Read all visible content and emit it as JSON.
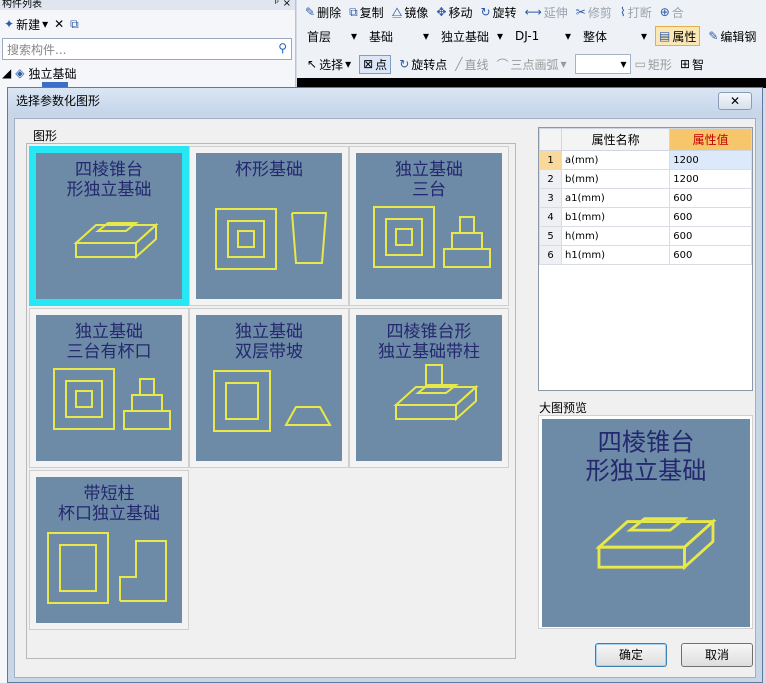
{
  "left_panel": {
    "title": "构件列表",
    "new_label": "新建",
    "search_placeholder": "搜索构件...",
    "tree_root": "独立基础"
  },
  "toolbar": {
    "row1": [
      "删除",
      "复制",
      "镜像",
      "移动",
      "旋转",
      "延伸",
      "修剪",
      "打断",
      "合"
    ],
    "row2": {
      "floor": "首层",
      "category": "基础",
      "type": "独立基础",
      "element": "DJ-1",
      "scope": "整体",
      "properties": "属性",
      "edit": "编辑钢"
    },
    "row3": {
      "select": "选择",
      "point": "点",
      "rotate_point": "旋转点",
      "line": "直线",
      "arc": "三点画弧",
      "rect": "矩形",
      "smart": "智"
    }
  },
  "dialog": {
    "title": "选择参数化图形",
    "close": "✕",
    "group_label": "图形",
    "shapes": [
      {
        "title1": "四棱锥台",
        "title2": "形独立基础"
      },
      {
        "title1": "杯形基础",
        "title2": ""
      },
      {
        "title1": "独立基础",
        "title2": "三台"
      },
      {
        "title1": "独立基础",
        "title2": "三台有杯口"
      },
      {
        "title1": "独立基础",
        "title2": "双层带坡"
      },
      {
        "title1": "四棱锥台形",
        "title2": "独立基础带柱"
      },
      {
        "title1": "带短柱",
        "title2": "杯口独立基础"
      }
    ],
    "properties": {
      "col_name": "属性名称",
      "col_value": "属性值",
      "rows": [
        {
          "idx": "1",
          "name": "a(mm)",
          "value": "1200"
        },
        {
          "idx": "2",
          "name": "b(mm)",
          "value": "1200"
        },
        {
          "idx": "3",
          "name": "a1(mm)",
          "value": "600"
        },
        {
          "idx": "4",
          "name": "b1(mm)",
          "value": "600"
        },
        {
          "idx": "5",
          "name": "h(mm)",
          "value": "600"
        },
        {
          "idx": "6",
          "name": "h1(mm)",
          "value": "600"
        }
      ]
    },
    "preview_label": "大图预览",
    "preview": {
      "title1": "四棱锥台",
      "title2": "形独立基础"
    },
    "ok": "确定",
    "cancel": "取消",
    "colors": {
      "tile_bg": "#6d8ba6",
      "line": "#e8e84a",
      "text": "#23286f",
      "selected": "#27e7f4"
    }
  }
}
